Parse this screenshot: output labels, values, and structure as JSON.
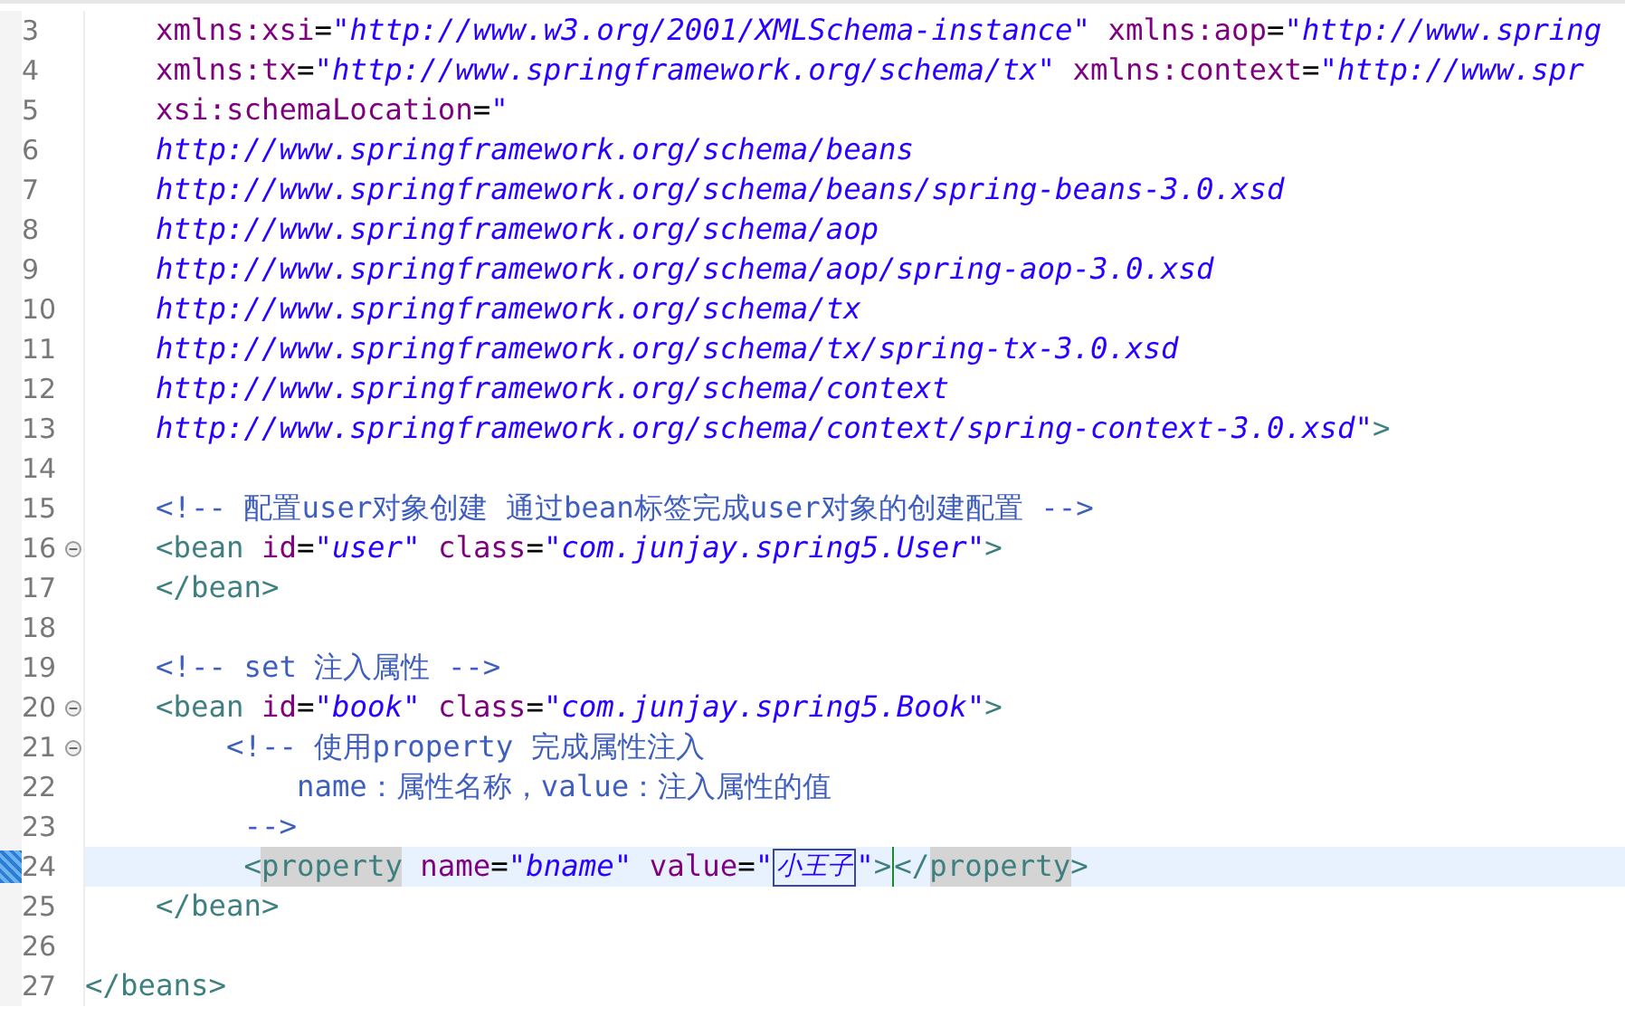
{
  "editor": {
    "lines": [
      {
        "number": "3",
        "fold": false,
        "current": false,
        "marker": false,
        "tokens": [
          {
            "kind": "attr",
            "text": "    xmlns:xsi"
          },
          {
            "kind": "eq",
            "text": "="
          },
          {
            "kind": "string",
            "text": "\"http://www.w3.org/2001/XMLSchema-instance\""
          },
          {
            "kind": "attr",
            "text": " xmlns:aop"
          },
          {
            "kind": "eq",
            "text": "="
          },
          {
            "kind": "string",
            "text": "\"http://www.spring"
          }
        ]
      },
      {
        "number": "4",
        "fold": false,
        "current": false,
        "marker": false,
        "tokens": [
          {
            "kind": "attr",
            "text": "    xmlns:tx"
          },
          {
            "kind": "eq",
            "text": "="
          },
          {
            "kind": "string",
            "text": "\"http://www.springframework.org/schema/tx\""
          },
          {
            "kind": "attr",
            "text": " xmlns:context"
          },
          {
            "kind": "eq",
            "text": "="
          },
          {
            "kind": "string",
            "text": "\"http://www.spr"
          }
        ]
      },
      {
        "number": "5",
        "fold": false,
        "current": false,
        "marker": false,
        "tokens": [
          {
            "kind": "attr",
            "text": "    xsi:schemaLocation"
          },
          {
            "kind": "eq",
            "text": "="
          },
          {
            "kind": "string",
            "text": "\""
          }
        ]
      },
      {
        "number": "6",
        "fold": false,
        "current": false,
        "marker": false,
        "tokens": [
          {
            "kind": "string",
            "text": "    http://www.springframework.org/schema/beans"
          }
        ]
      },
      {
        "number": "7",
        "fold": false,
        "current": false,
        "marker": false,
        "tokens": [
          {
            "kind": "string",
            "text": "    http://www.springframework.org/schema/beans/spring-beans-3.0.xsd"
          }
        ]
      },
      {
        "number": "8",
        "fold": false,
        "current": false,
        "marker": false,
        "tokens": [
          {
            "kind": "string",
            "text": "    http://www.springframework.org/schema/aop"
          }
        ]
      },
      {
        "number": "9",
        "fold": false,
        "current": false,
        "marker": false,
        "tokens": [
          {
            "kind": "string",
            "text": "    http://www.springframework.org/schema/aop/spring-aop-3.0.xsd"
          }
        ]
      },
      {
        "number": "10",
        "fold": false,
        "current": false,
        "marker": false,
        "tokens": [
          {
            "kind": "string",
            "text": "    http://www.springframework.org/schema/tx"
          }
        ]
      },
      {
        "number": "11",
        "fold": false,
        "current": false,
        "marker": false,
        "tokens": [
          {
            "kind": "string",
            "text": "    http://www.springframework.org/schema/tx/spring-tx-3.0.xsd"
          }
        ]
      },
      {
        "number": "12",
        "fold": false,
        "current": false,
        "marker": false,
        "tokens": [
          {
            "kind": "string",
            "text": "    http://www.springframework.org/schema/context"
          }
        ]
      },
      {
        "number": "13",
        "fold": false,
        "current": false,
        "marker": false,
        "tokens": [
          {
            "kind": "string",
            "text": "    http://www.springframework.org/schema/context/spring-context-3.0.xsd\""
          },
          {
            "kind": "tag",
            "text": ">"
          }
        ]
      },
      {
        "number": "14",
        "fold": false,
        "current": false,
        "marker": false
      },
      {
        "number": "15",
        "fold": false,
        "current": false,
        "marker": false,
        "tokens": [
          {
            "kind": "comment",
            "text": "    <!-- 配置user对象创建 通过bean标签完成user对象的创建配置 -->"
          }
        ]
      },
      {
        "number": "16",
        "fold": true,
        "current": false,
        "marker": false,
        "tokens": [
          {
            "kind": "tag",
            "text": "    <bean"
          },
          {
            "kind": "attr",
            "text": " id"
          },
          {
            "kind": "eq",
            "text": "="
          },
          {
            "kind": "string",
            "text": "\"user\""
          },
          {
            "kind": "attr",
            "text": " class"
          },
          {
            "kind": "eq",
            "text": "="
          },
          {
            "kind": "string",
            "text": "\"com.junjay.spring5.User\""
          },
          {
            "kind": "tag",
            "text": ">"
          }
        ]
      },
      {
        "number": "17",
        "fold": false,
        "current": false,
        "marker": false,
        "tokens": [
          {
            "kind": "tag",
            "text": "    </bean>"
          }
        ]
      },
      {
        "number": "18",
        "fold": false,
        "current": false,
        "marker": false
      },
      {
        "number": "19",
        "fold": false,
        "current": false,
        "marker": false,
        "tokens": [
          {
            "kind": "comment",
            "text": "    <!-- set 注入属性 -->"
          }
        ]
      },
      {
        "number": "20",
        "fold": true,
        "current": false,
        "marker": false,
        "tokens": [
          {
            "kind": "tag",
            "text": "    <bean"
          },
          {
            "kind": "attr",
            "text": " id"
          },
          {
            "kind": "eq",
            "text": "="
          },
          {
            "kind": "string",
            "text": "\"book\""
          },
          {
            "kind": "attr",
            "text": " class"
          },
          {
            "kind": "eq",
            "text": "="
          },
          {
            "kind": "string",
            "text": "\"com.junjay.spring5.Book\""
          },
          {
            "kind": "tag",
            "text": ">"
          }
        ]
      },
      {
        "number": "21",
        "fold": true,
        "current": false,
        "marker": false,
        "tokens": [
          {
            "kind": "comment",
            "text": "        <!-- 使用property 完成属性注入"
          }
        ]
      },
      {
        "number": "22",
        "fold": false,
        "current": false,
        "marker": false,
        "tokens": [
          {
            "kind": "comment",
            "text": "            name：属性名称，value：注入属性的值"
          }
        ]
      },
      {
        "number": "23",
        "fold": false,
        "current": false,
        "marker": false,
        "tokens": [
          {
            "kind": "comment",
            "text": "         -->"
          }
        ]
      },
      {
        "number": "24",
        "fold": false,
        "current": true,
        "marker": true,
        "tokens": [
          {
            "kind": "tag",
            "text": "         <",
            "highlighted": false,
            "boxed": false,
            "caret_after": false
          },
          {
            "kind": "tag",
            "text": "property",
            "highlighted": true,
            "boxed": false,
            "caret_after": false
          },
          {
            "kind": "attr",
            "text": " name",
            "highlighted": false,
            "boxed": false,
            "caret_after": false
          },
          {
            "kind": "eq",
            "text": "=",
            "highlighted": false,
            "boxed": false,
            "caret_after": false
          },
          {
            "kind": "string",
            "text": "\"bname\"",
            "highlighted": false,
            "boxed": false,
            "caret_after": false
          },
          {
            "kind": "attr",
            "text": " value",
            "highlighted": false,
            "boxed": false,
            "caret_after": false
          },
          {
            "kind": "eq",
            "text": "=",
            "highlighted": false,
            "boxed": false,
            "caret_after": false
          },
          {
            "kind": "string",
            "text": "\"",
            "highlighted": false,
            "boxed": false,
            "caret_after": false
          },
          {
            "kind": "string",
            "text": "小王子",
            "highlighted": false,
            "boxed": true,
            "caret_after": false
          },
          {
            "kind": "string",
            "text": "\"",
            "highlighted": false,
            "boxed": false,
            "caret_after": false
          },
          {
            "kind": "tag",
            "text": ">",
            "highlighted": false,
            "boxed": false,
            "caret_after": true
          },
          {
            "kind": "tag",
            "text": "</",
            "highlighted": false,
            "boxed": false,
            "caret_after": false
          },
          {
            "kind": "tag",
            "text": "property",
            "highlighted": true,
            "boxed": false,
            "caret_after": false
          },
          {
            "kind": "tag",
            "text": ">",
            "highlighted": false,
            "boxed": false,
            "caret_after": false
          }
        ]
      },
      {
        "number": "25",
        "fold": false,
        "current": false,
        "marker": false,
        "tokens": [
          {
            "kind": "tag",
            "text": "    </bean>"
          }
        ]
      },
      {
        "number": "26",
        "fold": false,
        "current": false,
        "marker": false
      },
      {
        "number": "27",
        "fold": false,
        "current": false,
        "marker": false,
        "tokens": [
          {
            "kind": "tag",
            "text": "</beans>"
          }
        ]
      }
    ]
  }
}
